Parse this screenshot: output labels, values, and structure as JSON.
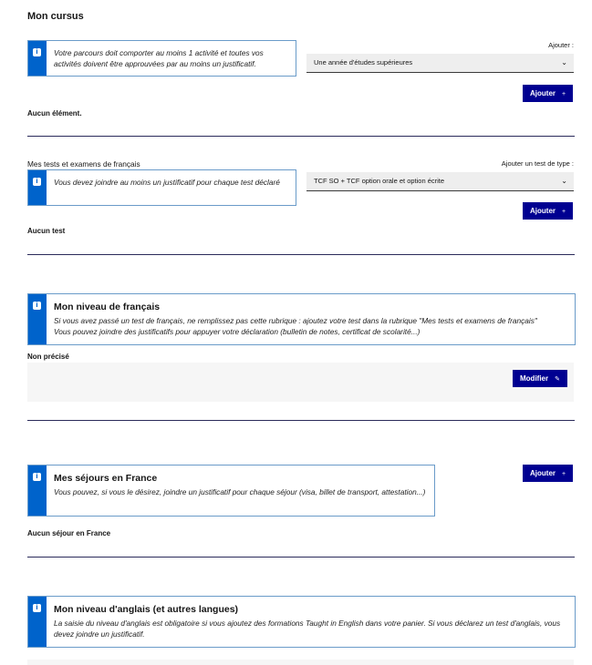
{
  "page": {
    "title": "Mon cursus"
  },
  "cursus": {
    "info": "Votre parcours doit comporter au moins 1 activité et toutes vos activités doivent être approuvées par au moins un justificatif.",
    "select_label": "Ajouter :",
    "select_value": "Une année d'études supérieures",
    "add_button": "Ajouter",
    "empty_text": "Aucun élément."
  },
  "tests": {
    "heading": "Mes tests et examens de français",
    "select_label": "Ajouter un test de type :",
    "info": "Vous devez joindre au moins un justificatif pour chaque test déclaré",
    "select_value": "TCF SO + TCF option orale et option écrite",
    "add_button": "Ajouter",
    "empty_text": "Aucun test"
  },
  "niveau": {
    "title": "Mon niveau de français",
    "line1": "Si vous avez passé un test de français, ne remplissez pas cette rubrique : ajoutez votre test dans la rubrique \"Mes tests et examens de français\"",
    "line2": "Vous pouvez joindre des justificatifs pour appuyer votre déclaration (bulletin de notes, certificat de scolarité...)",
    "status": "Non précisé",
    "modify_button": "Modifier"
  },
  "sejours": {
    "title": "Mes séjours en France",
    "text": "Vous pouvez, si vous le désirez, joindre un justificatif pour chaque séjour (visa, billet de transport, attestation...)",
    "add_button": "Ajouter",
    "empty_text": "Aucun séjour en France"
  },
  "anglais": {
    "title": "Mon niveau d'anglais (et autres langues)",
    "text": "La saisie du niveau d'anglais est obligatoire si vous ajoutez des formations Taught in English dans votre panier. Si vous déclarez un test d'anglais, vous devez joindre un justificatif."
  },
  "icons": {
    "info": "info-icon",
    "plus": "plus-icon",
    "pencil": "pencil-icon",
    "chevron": "chevron-down-icon"
  },
  "colors": {
    "primary": "#000091",
    "info_bar": "#0063cb",
    "info_border": "#6a9bc9"
  }
}
